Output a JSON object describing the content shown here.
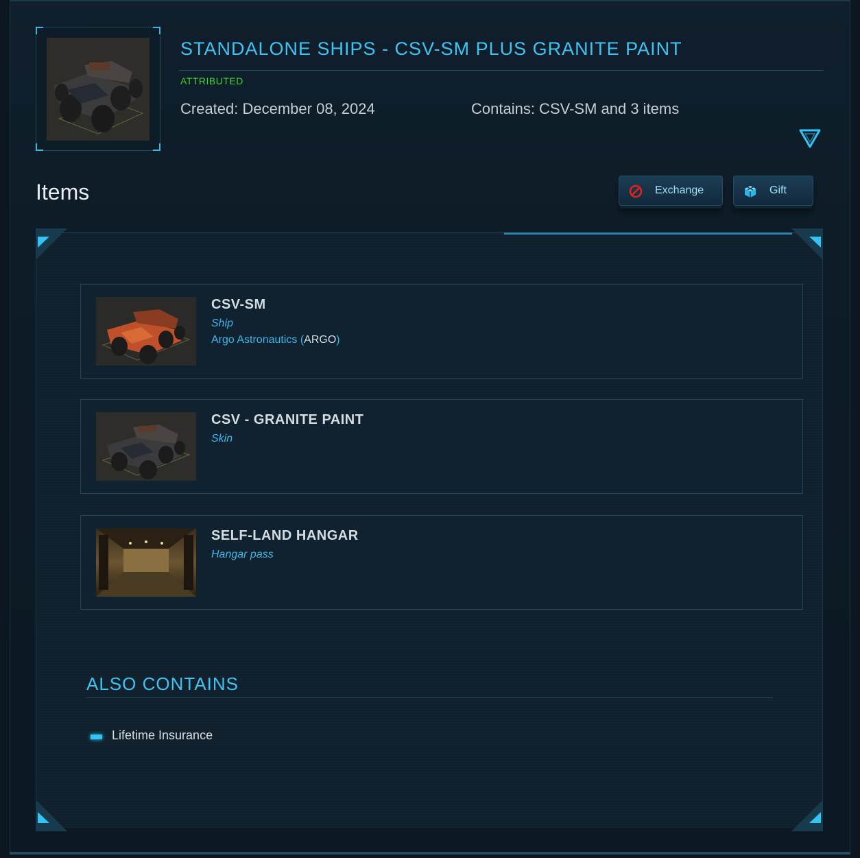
{
  "header": {
    "title": "STANDALONE SHIPS - CSV-SM PLUS GRANITE PAINT",
    "status": "ATTRIBUTED",
    "created": "Created: December 08, 2024",
    "contains": "Contains: CSV-SM and 3 items",
    "expand_icon": "triangle-down-icon",
    "accent_color": "#3fc3f3",
    "status_color": "#3ed62c"
  },
  "items_section": {
    "heading": "Items",
    "actions": {
      "exchange_label": "Exchange",
      "exchange_icon": "prohibited-icon",
      "gift_label": "Gift",
      "gift_icon": "gift-icon"
    }
  },
  "items": [
    {
      "name": "CSV-SM",
      "type": "Ship",
      "manufacturer": "Argo Astronautics (",
      "manufacturer_code": "ARGO",
      "manufacturer_close": ")"
    },
    {
      "name": "CSV - GRANITE PAINT",
      "type": "Skin"
    },
    {
      "name": "SELF-LAND HANGAR",
      "type": "Hangar pass"
    }
  ],
  "also_contains": {
    "heading": "ALSO CONTAINS",
    "entries": [
      "Lifetime Insurance"
    ]
  }
}
